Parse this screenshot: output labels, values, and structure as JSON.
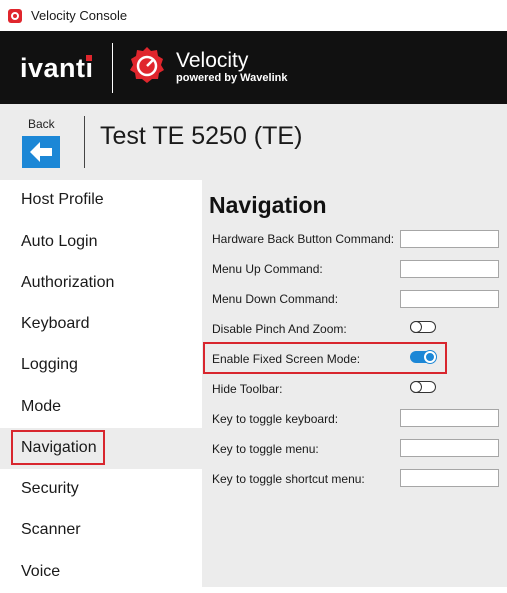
{
  "window": {
    "title": "Velocity Console"
  },
  "banner": {
    "brand": "ivanti",
    "product_name": "Velocity",
    "product_tagline": "powered by Wavelink"
  },
  "header": {
    "back_label": "Back",
    "page_title": "Test TE 5250 (TE)"
  },
  "sidebar": {
    "items": [
      {
        "label": "Host Profile"
      },
      {
        "label": "Auto Login"
      },
      {
        "label": "Authorization"
      },
      {
        "label": "Keyboard"
      },
      {
        "label": "Logging"
      },
      {
        "label": "Mode"
      },
      {
        "label": "Navigation",
        "selected": true
      },
      {
        "label": "Security"
      },
      {
        "label": "Scanner"
      },
      {
        "label": "Voice"
      }
    ]
  },
  "main": {
    "title": "Navigation",
    "settings": [
      {
        "label": "Hardware Back Button Command:",
        "control": "text",
        "value": ""
      },
      {
        "label": "Menu Up Command:",
        "control": "text",
        "value": ""
      },
      {
        "label": "Menu Down Command:",
        "control": "text",
        "value": ""
      },
      {
        "label": "Disable Pinch And Zoom:",
        "control": "toggle",
        "on": false
      },
      {
        "label": "Enable Fixed Screen Mode:",
        "control": "toggle",
        "on": true
      },
      {
        "label": "Hide Toolbar:",
        "control": "toggle",
        "on": false
      },
      {
        "label": "Key to toggle keyboard:",
        "control": "text",
        "value": ""
      },
      {
        "label": "Key to toggle menu:",
        "control": "text",
        "value": ""
      },
      {
        "label": "Key to toggle shortcut menu:",
        "control": "text",
        "value": ""
      }
    ]
  },
  "colors": {
    "accent": "#1c87d6",
    "highlight": "#d8262e",
    "brand_red": "#e0262d",
    "banner_bg": "#111111",
    "panel_bg": "#ececec"
  },
  "icons": {
    "app": "velocity-app-icon",
    "back": "arrow-left-icon",
    "logo": "velocity-logo-icon"
  }
}
